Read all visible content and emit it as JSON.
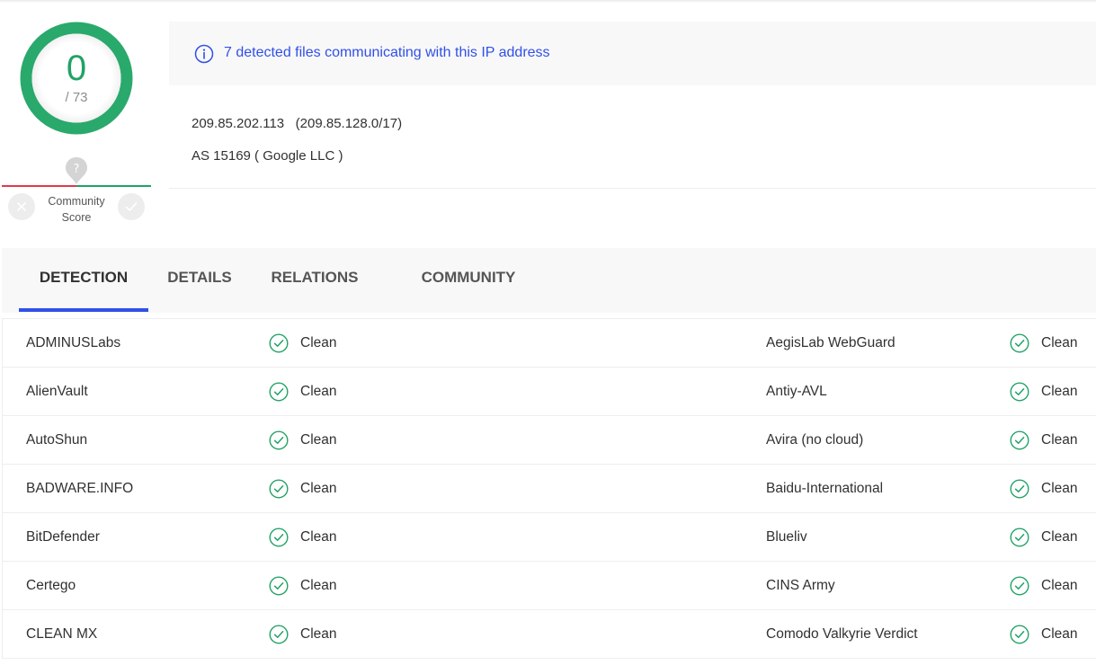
{
  "score": {
    "detections": "0",
    "total": "/ 73",
    "accent_color": "#21a366"
  },
  "community": {
    "label_line1": "Community",
    "label_line2": "Score",
    "pin_icon": "question-mark-icon",
    "down_icon": "x-icon",
    "up_icon": "check-icon"
  },
  "info": {
    "banner_text": "7 detected files communicating with this IP address",
    "banner_icon": "info-icon",
    "ip": "209.85.202.113",
    "cidr": "(209.85.128.0/17)",
    "as": "AS 15169 ( Google LLC )"
  },
  "tabs": [
    {
      "label": "DETECTION",
      "active": true
    },
    {
      "label": "DETAILS",
      "active": false
    },
    {
      "label": "RELATIONS",
      "active": false
    },
    {
      "label": "COMMUNITY",
      "active": false
    }
  ],
  "detections": [
    {
      "left": {
        "engine": "ADMINUSLabs",
        "result": "Clean"
      },
      "right": {
        "engine": "AegisLab WebGuard",
        "result": "Clean"
      }
    },
    {
      "left": {
        "engine": "AlienVault",
        "result": "Clean"
      },
      "right": {
        "engine": "Antiy-AVL",
        "result": "Clean"
      }
    },
    {
      "left": {
        "engine": "AutoShun",
        "result": "Clean"
      },
      "right": {
        "engine": "Avira (no cloud)",
        "result": "Clean"
      }
    },
    {
      "left": {
        "engine": "BADWARE.INFO",
        "result": "Clean"
      },
      "right": {
        "engine": "Baidu-International",
        "result": "Clean"
      }
    },
    {
      "left": {
        "engine": "BitDefender",
        "result": "Clean"
      },
      "right": {
        "engine": "Blueliv",
        "result": "Clean"
      }
    },
    {
      "left": {
        "engine": "Certego",
        "result": "Clean"
      },
      "right": {
        "engine": "CINS Army",
        "result": "Clean"
      }
    },
    {
      "left": {
        "engine": "CLEAN MX",
        "result": "Clean"
      },
      "right": {
        "engine": "Comodo Valkyrie Verdict",
        "result": "Clean"
      }
    }
  ]
}
